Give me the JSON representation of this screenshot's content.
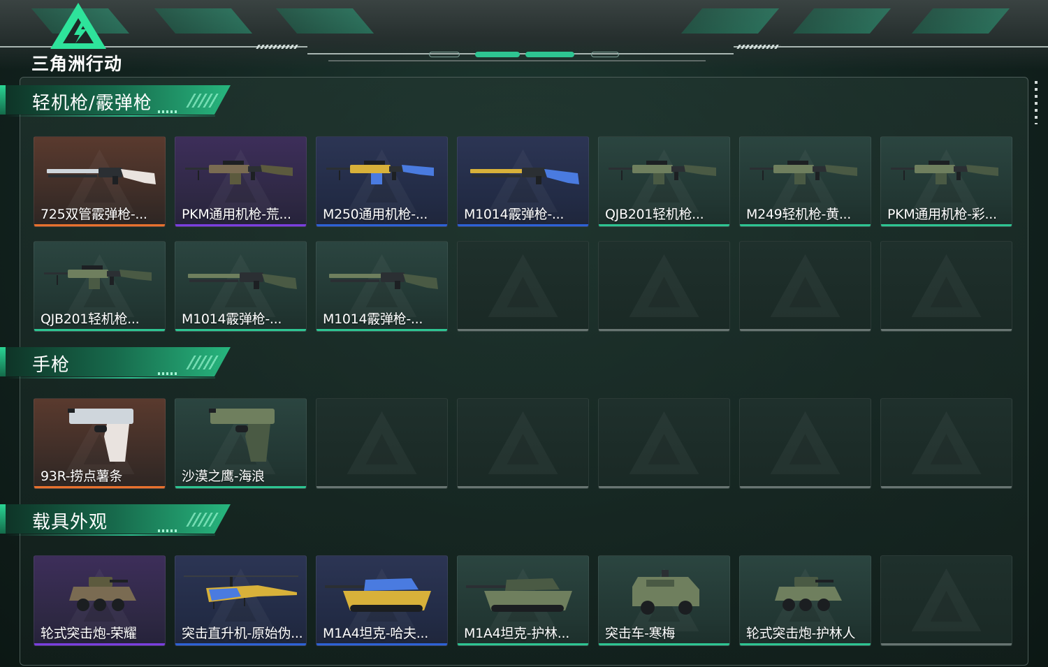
{
  "app": {
    "title": "三角洲行动"
  },
  "colors": {
    "accent": "#2ec592",
    "rarity_orange": "#e8722e",
    "rarity_purple": "#7a3fe0",
    "rarity_blue": "#2d62d6",
    "rarity_green": "#2ec592",
    "empty_slot": "#8a9593"
  },
  "sections": [
    {
      "title": "轻机枪/霰弹枪",
      "items": [
        {
          "label": "725双管霰弹枪-...",
          "rarity": "orange",
          "icon": "shotgun-icon"
        },
        {
          "label": "PKM通用机枪-荒...",
          "rarity": "purple",
          "icon": "machine-gun-icon"
        },
        {
          "label": "M250通用机枪-...",
          "rarity": "blue",
          "icon": "machine-gun-icon"
        },
        {
          "label": "M1014霰弹枪-...",
          "rarity": "blue",
          "icon": "shotgun-icon"
        },
        {
          "label": "QJB201轻机枪...",
          "rarity": "green",
          "icon": "machine-gun-icon"
        },
        {
          "label": "M249轻机枪-黄...",
          "rarity": "green",
          "icon": "machine-gun-icon"
        },
        {
          "label": "PKM通用机枪-彩...",
          "rarity": "green",
          "icon": "machine-gun-icon"
        },
        {
          "label": "QJB201轻机枪...",
          "rarity": "green",
          "icon": "machine-gun-icon"
        },
        {
          "label": "M1014霰弹枪-...",
          "rarity": "green",
          "icon": "shotgun-icon"
        },
        {
          "label": "M1014霰弹枪-...",
          "rarity": "green",
          "icon": "shotgun-icon"
        },
        null,
        null,
        null,
        null
      ]
    },
    {
      "title": "手枪",
      "items": [
        {
          "label": "93R-捞点薯条",
          "rarity": "orange",
          "icon": "pistol-icon"
        },
        {
          "label": "沙漠之鹰-海浪",
          "rarity": "green",
          "icon": "pistol-icon"
        },
        null,
        null,
        null,
        null,
        null
      ]
    },
    {
      "title": "载具外观",
      "items": [
        {
          "label": "轮式突击炮-荣耀",
          "rarity": "purple",
          "icon": "armored-vehicle-icon"
        },
        {
          "label": "突击直升机-原始伪...",
          "rarity": "blue",
          "icon": "helicopter-icon"
        },
        {
          "label": "M1A4坦克-哈夫...",
          "rarity": "blue",
          "icon": "tank-icon"
        },
        {
          "label": "M1A4坦克-护林...",
          "rarity": "green",
          "icon": "tank-icon"
        },
        {
          "label": "突击车-寒梅",
          "rarity": "green",
          "icon": "assault-vehicle-icon"
        },
        {
          "label": "轮式突击炮-护林人",
          "rarity": "green",
          "icon": "armored-vehicle-icon"
        },
        null
      ]
    }
  ]
}
